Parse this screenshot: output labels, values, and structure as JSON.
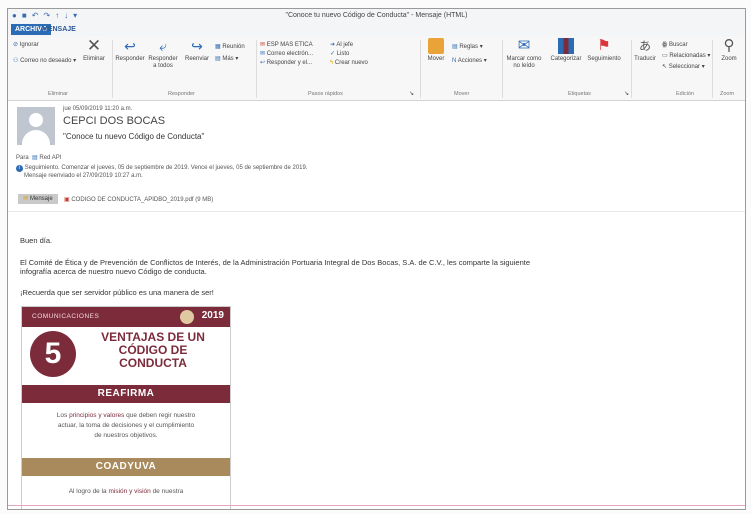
{
  "window": {
    "title": "\"Conoce tu nuevo Código de Conducta\" - Mensaje (HTML)",
    "tabs": [
      "ARCHIVO",
      "MENSAJE"
    ]
  },
  "ribbon": {
    "delete_group": {
      "ignore": "Ignorar",
      "junk": "Correo no deseado ▾",
      "delete": "Eliminar",
      "label": "Eliminar"
    },
    "respond_group": {
      "reply": "Responder",
      "reply_all": "Responder a todos",
      "forward": "Reenviar",
      "meeting": "Reunión",
      "more": "Más ▾",
      "label": "Responder"
    },
    "quick_steps": {
      "items": [
        "ESP MAS ETICA",
        "Correo electrón...",
        "Responder y el...",
        "Al jefe",
        "Listo",
        "Crear nuevo"
      ],
      "label": "Pasos rápidos"
    },
    "move_group": {
      "move": "Mover",
      "rules": "Reglas ▾",
      "actions": "Acciones ▾",
      "label": "Mover"
    },
    "tags_group": {
      "mark_unread": "Marcar como no leído",
      "categorize": "Categorizar",
      "followup": "Seguimiento",
      "label": "Etiquetas"
    },
    "translate": "Traducir",
    "edit_group": {
      "find": "Buscar",
      "related": "Relacionadas ▾",
      "select": "Seleccionar ▾",
      "label": "Edición"
    },
    "zoom": "Zoom",
    "zoom_label": "Zoom"
  },
  "message": {
    "date": "jue 05/09/2019 11:20 a.m.",
    "sender": "CEPCI DOS BOCAS",
    "subject": "\"Conoce tu nuevo Código de Conducta\"",
    "to_label": "Para",
    "to_value": "Red API",
    "followup": "Seguimiento. Comenzar el jueves, 05 de septiembre de 2019. Vence el jueves, 05 de septiembre de 2019.",
    "forwarded": "Mensaje reenviado el 27/09/2019 10:27 a.m.",
    "message_tab": "Mensaje",
    "attachment": "CODIGO DE CONDUCTA_APIDBO_2019.pdf (9 MB)"
  },
  "body": {
    "greeting": "Buen día.",
    "paragraph1_line1": "El Comité de Ética y de Prevención de Conflictos de Interés, de la Administración Portuaria Integral de Dos Bocas, S.A. de C.V., les comparte la siguiente",
    "paragraph1_line2": "infografía acerca de nuestro nuevo Código de conducta.",
    "motto": "¡Recuerda que ser servidor público es una manera de ser!"
  },
  "infographic": {
    "header": "COMUNICACIONES",
    "year": "2019",
    "number": "5",
    "title_line1": "VENTAJAS DE UN",
    "title_line2": "CÓDIGO DE",
    "title_line3": "CONDUCTA",
    "band1": "REAFIRMA",
    "text1_a": "Los",
    "text1_hl": "principios y valores",
    "text1_b": "que deben regir nuestro",
    "text1_line2": "actuar, la toma de decisiones y el cumplimiento",
    "text1_line3": "de nuestros objetivos.",
    "band2": "COADYUVA",
    "text2_a": "Al logro de la",
    "text2_hl": "misión y visión",
    "text2_b": "de nuestra"
  },
  "colors": {
    "accent": "#2b6cb5",
    "maroon": "#7c2b3b",
    "gold": "#a88a5c"
  }
}
